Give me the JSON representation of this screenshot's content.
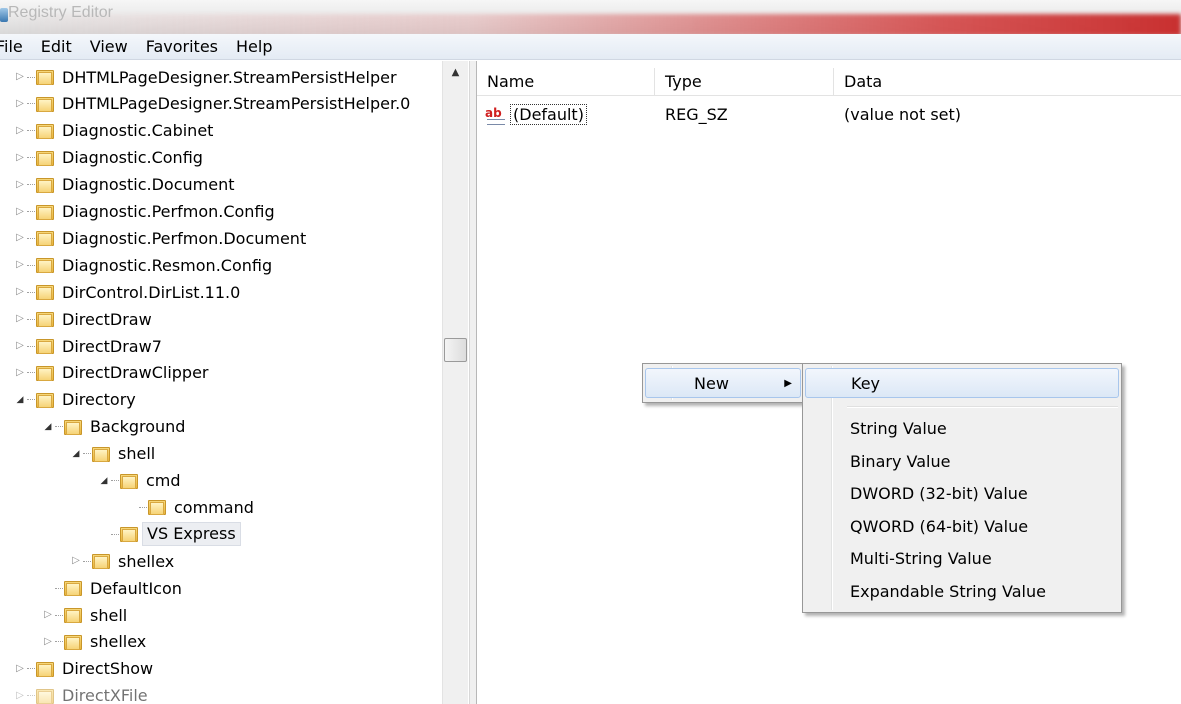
{
  "window": {
    "title": "Registry Editor"
  },
  "menubar": {
    "items": [
      "File",
      "Edit",
      "View",
      "Favorites",
      "Help"
    ]
  },
  "tree": {
    "items": [
      {
        "label": "DHTMLPageDesigner.StreamPersistHelper",
        "depth": 0,
        "expander": "collapsed"
      },
      {
        "label": "DHTMLPageDesigner.StreamPersistHelper.0",
        "depth": 0,
        "expander": "collapsed"
      },
      {
        "label": "Diagnostic.Cabinet",
        "depth": 0,
        "expander": "collapsed"
      },
      {
        "label": "Diagnostic.Config",
        "depth": 0,
        "expander": "collapsed"
      },
      {
        "label": "Diagnostic.Document",
        "depth": 0,
        "expander": "collapsed"
      },
      {
        "label": "Diagnostic.Perfmon.Config",
        "depth": 0,
        "expander": "collapsed"
      },
      {
        "label": "Diagnostic.Perfmon.Document",
        "depth": 0,
        "expander": "collapsed"
      },
      {
        "label": "Diagnostic.Resmon.Config",
        "depth": 0,
        "expander": "collapsed"
      },
      {
        "label": "DirControl.DirList.11.0",
        "depth": 0,
        "expander": "collapsed"
      },
      {
        "label": "DirectDraw",
        "depth": 0,
        "expander": "collapsed"
      },
      {
        "label": "DirectDraw7",
        "depth": 0,
        "expander": "collapsed"
      },
      {
        "label": "DirectDrawClipper",
        "depth": 0,
        "expander": "collapsed"
      },
      {
        "label": "Directory",
        "depth": 0,
        "expander": "expanded"
      },
      {
        "label": "Background",
        "depth": 1,
        "expander": "expanded"
      },
      {
        "label": "shell",
        "depth": 2,
        "expander": "expanded"
      },
      {
        "label": "cmd",
        "depth": 3,
        "expander": "expanded"
      },
      {
        "label": "command",
        "depth": 4,
        "expander": "none"
      },
      {
        "label": "VS Express",
        "depth": 3,
        "expander": "none",
        "selected": true
      },
      {
        "label": "shellex",
        "depth": 2,
        "expander": "collapsed"
      },
      {
        "label": "DefaultIcon",
        "depth": 1,
        "expander": "none"
      },
      {
        "label": "shell",
        "depth": 1,
        "expander": "collapsed"
      },
      {
        "label": "shellex",
        "depth": 1,
        "expander": "collapsed"
      },
      {
        "label": "DirectShow",
        "depth": 0,
        "expander": "collapsed"
      },
      {
        "label": "DirectXFile",
        "depth": 0,
        "expander": "collapsed"
      }
    ]
  },
  "list": {
    "columns": [
      "Name",
      "Type",
      "Data"
    ],
    "rows": [
      {
        "name": "(Default)",
        "type": "REG_SZ",
        "data": "(value not set)",
        "icon": "string-value-icon"
      }
    ]
  },
  "context_menu": {
    "items": [
      {
        "label": "New",
        "has_submenu": true
      }
    ]
  },
  "submenu": {
    "top_item": "Key",
    "items": [
      "String Value",
      "Binary Value",
      "DWORD (32-bit) Value",
      "QWORD (64-bit) Value",
      "Multi-String Value",
      "Expandable String Value"
    ]
  }
}
